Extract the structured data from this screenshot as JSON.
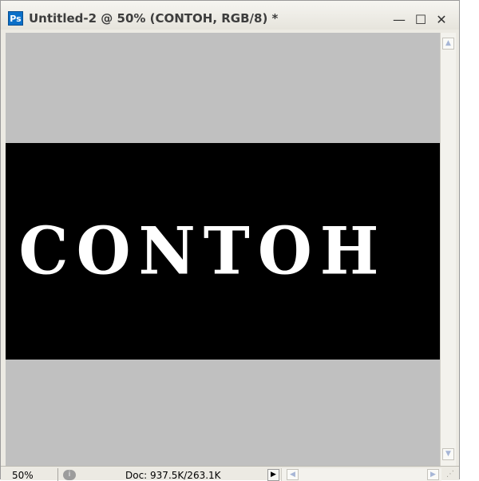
{
  "window": {
    "title": "Untitled-2 @ 50% (CONTOH, RGB/8) *",
    "app_icon": "photoshop-icon",
    "app_icon_label": "Ps",
    "minimize_glyph": "—",
    "maximize_glyph": "☐",
    "close_glyph": "✕"
  },
  "canvas": {
    "background_color": "#c0c0c0",
    "artwork_color": "#000000",
    "artwork_text": "CONTOH",
    "text_color": "#ffffff"
  },
  "statusbar": {
    "zoom": "50%",
    "doc_info": "Doc: 937.5K/263.1K",
    "status_icon": "status-info-icon",
    "menu_arrow_glyph": "▶"
  },
  "scrollbars": {
    "vertical_up_glyph": "▲",
    "vertical_down_glyph": "▼",
    "horizontal_left_glyph": "◀",
    "horizontal_right_glyph": "▶"
  }
}
